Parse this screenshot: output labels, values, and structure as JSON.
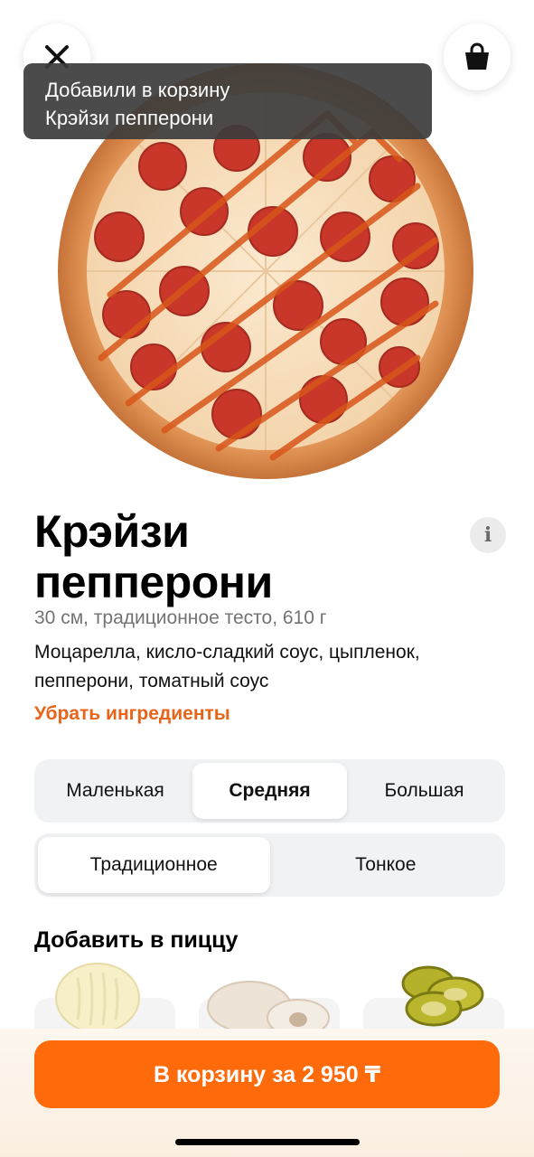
{
  "toast": {
    "line1": "Добавили в корзину",
    "line2": "Крэйзи пепперони"
  },
  "product": {
    "name_line1": "Крэйзи",
    "name_line2": "пепперони",
    "subtitle": "30 см, традиционное тесто, 610 г",
    "description": "Моцарелла, кисло-сладкий соус, цыпленок, пепперони, томатный соус",
    "remove_ingredients": "Убрать ингредиенты"
  },
  "sizes": {
    "options": [
      "Маленькая",
      "Средняя",
      "Большая"
    ],
    "selected": "Средняя"
  },
  "dough": {
    "options": [
      "Традиционное",
      "Тонкое"
    ],
    "selected": "Традиционное"
  },
  "toppings": {
    "title": "Добавить в пиццу"
  },
  "cta": {
    "label": "В корзину за 2 950 ₸"
  },
  "icons": {
    "close": "close-icon",
    "cart": "bag-icon",
    "info": "info-icon"
  },
  "colors": {
    "accent": "#ff6a0b",
    "link": "#e8641b"
  }
}
